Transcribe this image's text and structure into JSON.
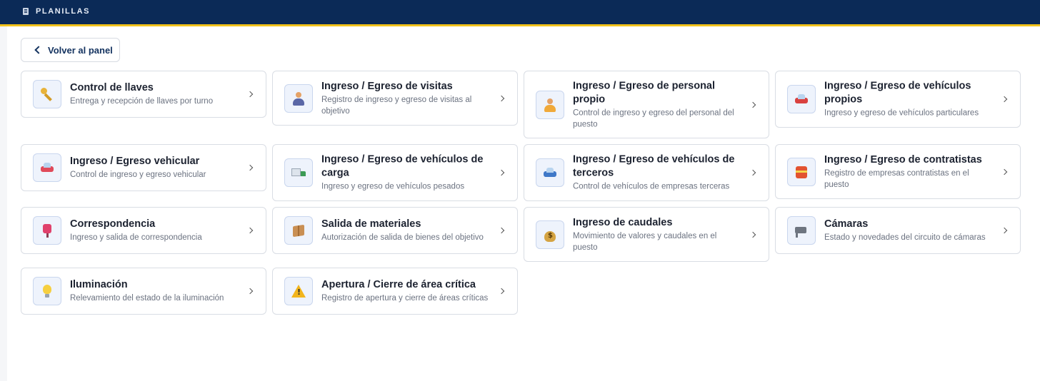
{
  "header": {
    "title": "PLANILLAS",
    "logo_icon": "clipboard-icon",
    "background_color": "#0b2a57",
    "accent_color": "#f2c21b"
  },
  "back_button": {
    "label": "Volver al panel",
    "icon": "chevron-left-icon"
  },
  "cards": [
    {
      "title": "Control de llaves",
      "description": "Entrega y recepción de llaves por turno",
      "icon": "key-icon"
    },
    {
      "title": "Ingreso / Egreso de visitas",
      "description": "Registro de ingreso y egreso de visitas al objetivo",
      "icon": "visitor-icon"
    },
    {
      "title": "Ingreso / Egreso de personal propio",
      "description": "Control de ingreso y egreso del personal del puesto",
      "icon": "worker-icon"
    },
    {
      "title": "Ingreso / Egreso de vehículos propios",
      "description": "Ingreso y egreso de vehículos particulares",
      "icon": "car-icon"
    },
    {
      "title": "Ingreso / Egreso vehicular",
      "description": "Control de ingreso y egreso vehicular",
      "icon": "car-front-icon"
    },
    {
      "title": "Ingreso / Egreso de vehículos de carga",
      "description": "Ingreso y egreso de vehículos pesados",
      "icon": "truck-icon"
    },
    {
      "title": "Ingreso / Egreso de vehículos de terceros",
      "description": "Control de vehículos de empresas terceras",
      "icon": "blue-car-icon"
    },
    {
      "title": "Ingreso / Egreso de contratistas",
      "description": "Registro de empresas contratistas en el puesto",
      "icon": "safety-vest-icon"
    },
    {
      "title": "Correspondencia",
      "description": "Ingreso y salida de correspondencia",
      "icon": "mailbox-icon"
    },
    {
      "title": "Salida de materiales",
      "description": "Autorización de salida de bienes del objetivo",
      "icon": "package-icon"
    },
    {
      "title": "Ingreso de caudales",
      "description": "Movimiento de valores y caudales en el puesto",
      "icon": "money-bag-icon"
    },
    {
      "title": "Cámaras",
      "description": "Estado y novedades del circuito de cámaras",
      "icon": "security-camera-icon"
    },
    {
      "title": "Iluminación",
      "description": "Relevamiento del estado de la iluminación",
      "icon": "light-bulb-icon"
    },
    {
      "title": "Apertura / Cierre de área crítica",
      "description": "Registro de apertura y cierre de áreas críticas",
      "icon": "warning-icon"
    }
  ]
}
